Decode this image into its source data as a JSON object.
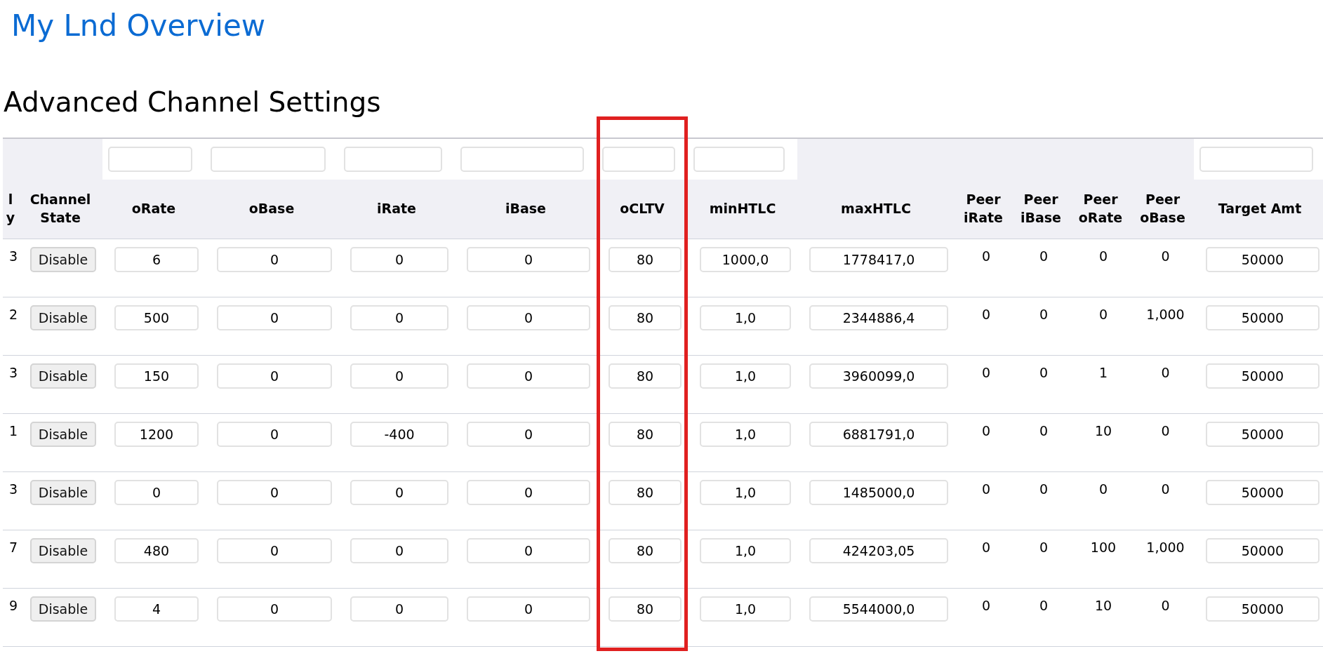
{
  "page_title": "My Lnd Overview",
  "section_title": "Advanced Channel Settings",
  "columns": [
    {
      "label": "l y",
      "kind": "text",
      "filter": false,
      "highlighted": false
    },
    {
      "label": "Channel State",
      "kind": "button",
      "filter": false,
      "highlighted": false
    },
    {
      "label": "oRate",
      "kind": "input",
      "filter": true,
      "highlighted": false
    },
    {
      "label": "oBase",
      "kind": "input",
      "filter": true,
      "highlighted": false
    },
    {
      "label": "iRate",
      "kind": "input",
      "filter": true,
      "highlighted": false
    },
    {
      "label": "iBase",
      "kind": "input",
      "filter": true,
      "highlighted": false
    },
    {
      "label": "oCLTV",
      "kind": "input",
      "filter": true,
      "highlighted": true
    },
    {
      "label": "minHTLC",
      "kind": "input",
      "filter": true,
      "highlighted": false
    },
    {
      "label": "maxHTLC",
      "kind": "input",
      "filter": false,
      "highlighted": false
    },
    {
      "label": "Peer iRate",
      "kind": "text",
      "filter": false,
      "highlighted": false
    },
    {
      "label": "Peer iBase",
      "kind": "text",
      "filter": false,
      "highlighted": false
    },
    {
      "label": "Peer oRate",
      "kind": "text",
      "filter": false,
      "highlighted": false
    },
    {
      "label": "Peer oBase",
      "kind": "text",
      "filter": false,
      "highlighted": false
    },
    {
      "label": "Target Amt",
      "kind": "input",
      "filter": true,
      "highlighted": false
    }
  ],
  "rows": [
    {
      "cells": [
        "3",
        "Disable",
        "6",
        "0",
        "0",
        "0",
        "80",
        "1000,0",
        "1778417,0",
        "0",
        "0",
        "0",
        "0",
        "50000"
      ]
    },
    {
      "cells": [
        "2",
        "Disable",
        "500",
        "0",
        "0",
        "0",
        "80",
        "1,0",
        "2344886,4",
        "0",
        "0",
        "0",
        "1,000",
        "50000"
      ]
    },
    {
      "cells": [
        "3",
        "Disable",
        "150",
        "0",
        "0",
        "0",
        "80",
        "1,0",
        "3960099,0",
        "0",
        "0",
        "1",
        "0",
        "50000"
      ]
    },
    {
      "cells": [
        "1",
        "Disable",
        "1200",
        "0",
        "-400",
        "0",
        "80",
        "1,0",
        "6881791,0",
        "0",
        "0",
        "10",
        "0",
        "50000"
      ]
    },
    {
      "cells": [
        "3",
        "Disable",
        "0",
        "0",
        "0",
        "0",
        "80",
        "1,0",
        "1485000,0",
        "0",
        "0",
        "0",
        "0",
        "50000"
      ]
    },
    {
      "cells": [
        "7",
        "Disable",
        "480",
        "0",
        "0",
        "0",
        "80",
        "1,0",
        "424203,05",
        "0",
        "0",
        "100",
        "1,000",
        "50000"
      ]
    },
    {
      "cells": [
        "9",
        "Disable",
        "4",
        "0",
        "0",
        "0",
        "80",
        "1,0",
        "5544000,0",
        "0",
        "0",
        "10",
        "0",
        "50000"
      ]
    }
  ]
}
